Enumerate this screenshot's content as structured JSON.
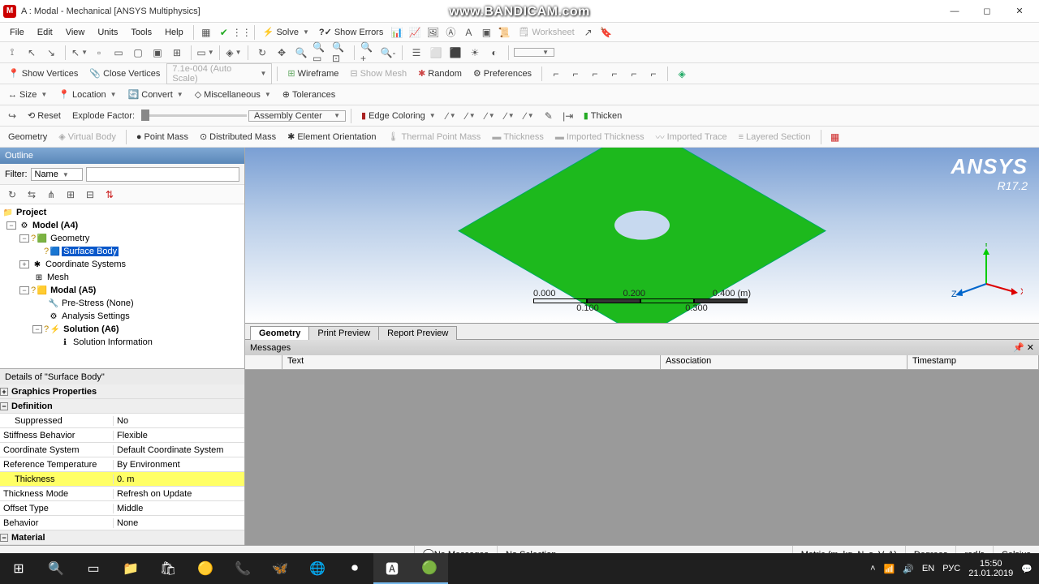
{
  "title": "A : Modal - Mechanical [ANSYS Multiphysics]",
  "bandicam": "www.BANDICAM.com",
  "menu": [
    "File",
    "Edit",
    "View",
    "Units",
    "Tools",
    "Help"
  ],
  "tb_solve": "Solve",
  "tb_show_errors": "Show Errors",
  "tb_worksheet": "Worksheet",
  "tb2": {
    "show_vertices": "Show Vertices",
    "close_vertices": "Close Vertices",
    "autoscale": "7.1e-004 (Auto Scale)",
    "wireframe": "Wireframe",
    "show_mesh": "Show Mesh",
    "random": "Random",
    "preferences": "Preferences"
  },
  "tb3": {
    "size": "Size",
    "location": "Location",
    "convert": "Convert",
    "misc": "Miscellaneous",
    "tolerances": "Tolerances"
  },
  "tb4": {
    "reset": "Reset",
    "explode": "Explode Factor:",
    "assembly": "Assembly Center",
    "edge": "Edge Coloring",
    "thicken": "Thicken"
  },
  "ctx": {
    "geometry": "Geometry",
    "virtual": "Virtual Body",
    "point_mass": "Point Mass",
    "dist_mass": "Distributed Mass",
    "elem_orient": "Element Orientation",
    "thermal": "Thermal Point Mass",
    "thickness": "Thickness",
    "imp_thick": "Imported Thickness",
    "imp_trace": "Imported Trace",
    "layered": "Layered Section"
  },
  "outline": {
    "title": "Outline",
    "filter_label": "Filter:",
    "filter_value": "Name",
    "tree": {
      "project": "Project",
      "model": "Model (A4)",
      "geometry": "Geometry",
      "surface_body": "Surface Body",
      "coord": "Coordinate Systems",
      "mesh": "Mesh",
      "modal": "Modal (A5)",
      "prestress": "Pre-Stress (None)",
      "analysis": "Analysis Settings",
      "solution": "Solution (A6)",
      "sol_info": "Solution Information"
    }
  },
  "details": {
    "title": "Details of \"Surface Body\"",
    "groups": {
      "graphics": "Graphics Properties",
      "definition": "Definition",
      "material": "Material"
    },
    "rows": [
      {
        "k": "Suppressed",
        "v": "No"
      },
      {
        "k": "Stiffness Behavior",
        "v": "Flexible"
      },
      {
        "k": "Coordinate System",
        "v": "Default Coordinate System"
      },
      {
        "k": "Reference Temperature",
        "v": "By Environment"
      },
      {
        "k": "Thickness",
        "v": "0. m",
        "hl": true
      },
      {
        "k": "Thickness Mode",
        "v": "Refresh on Update"
      },
      {
        "k": "Offset Type",
        "v": "Middle"
      },
      {
        "k": "Behavior",
        "v": "None"
      }
    ]
  },
  "view": {
    "ansys": "ANSYS",
    "ver": "R17.2",
    "scale_top": [
      "0.000",
      "0.200",
      "0.400 (m)"
    ],
    "scale_bot": [
      "0.100",
      "0.300"
    ],
    "axes": {
      "x": "X",
      "y": "Y",
      "z": "Z"
    }
  },
  "tabs": [
    "Geometry",
    "Print Preview",
    "Report Preview"
  ],
  "messages": {
    "title": "Messages",
    "cols": [
      "",
      "Text",
      "Association",
      "Timestamp"
    ]
  },
  "status": {
    "nomsg": "No Messages",
    "nosel": "No Selection",
    "units": "Metric (m, kg, N, s, V, A)",
    "deg": "Degrees",
    "rads": "rad/s",
    "cel": "Celsius"
  },
  "tray": {
    "lang1": "EN",
    "lang2": "РУС",
    "time": "15:50",
    "date": "21.01.2019"
  }
}
